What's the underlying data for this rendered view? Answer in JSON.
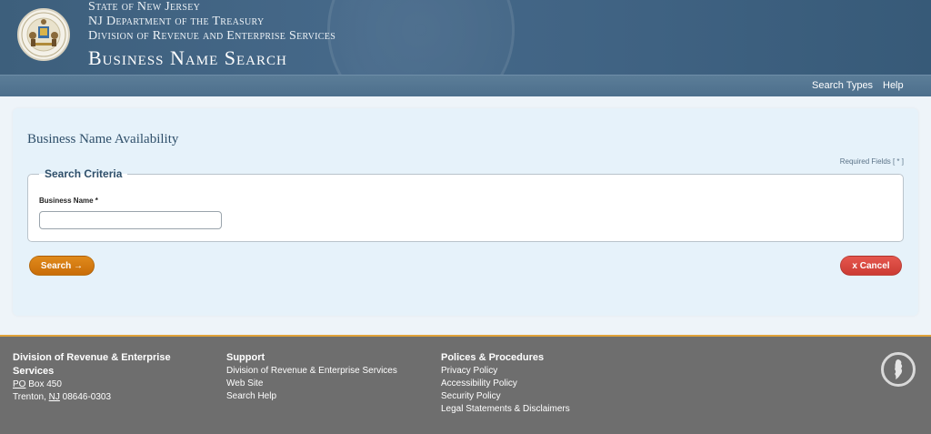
{
  "header": {
    "state_line": "State of New Jersey",
    "dept_line": "NJ Department of the Treasury",
    "division_line": "Division of Revenue and Enterprise Services",
    "app_title": "Business Name Search"
  },
  "nav": {
    "search_types": "Search Types",
    "help": "Help"
  },
  "main": {
    "page_title": "Business Name Availability",
    "required_note": "Required Fields [ * ]",
    "fieldset_legend": "Search Criteria",
    "business_name_label": "Business Name *",
    "business_name_value": "",
    "search_button": "Search →",
    "cancel_button": "x Cancel"
  },
  "footer": {
    "col1": {
      "heading_line1": "Division of Revenue & Enterprise",
      "heading_line2": "Services",
      "po_abbr": "PO",
      "po_rest": " Box 450",
      "city": "Trenton, ",
      "state_abbr": "NJ",
      "zip": " 08646-0303"
    },
    "col2": {
      "heading": "Support",
      "links": [
        "Division of Revenue & Enterprise Services",
        "Web Site",
        "Search Help"
      ]
    },
    "col3": {
      "heading": "Polices & Procedures",
      "links": [
        "Privacy Policy",
        "Accessibility Policy",
        "Security Policy",
        "Legal Statements & Disclaimers"
      ]
    }
  },
  "colors": {
    "header_bg": "#46698a",
    "search_button": "#d97b12",
    "cancel_button": "#dc4a42",
    "footer_bg": "#6e6e6e",
    "footer_accent": "#e0a23a"
  },
  "icons": [
    "nj-state-seal-icon",
    "nj-state-outline-icon",
    "arrow-right-icon"
  ]
}
